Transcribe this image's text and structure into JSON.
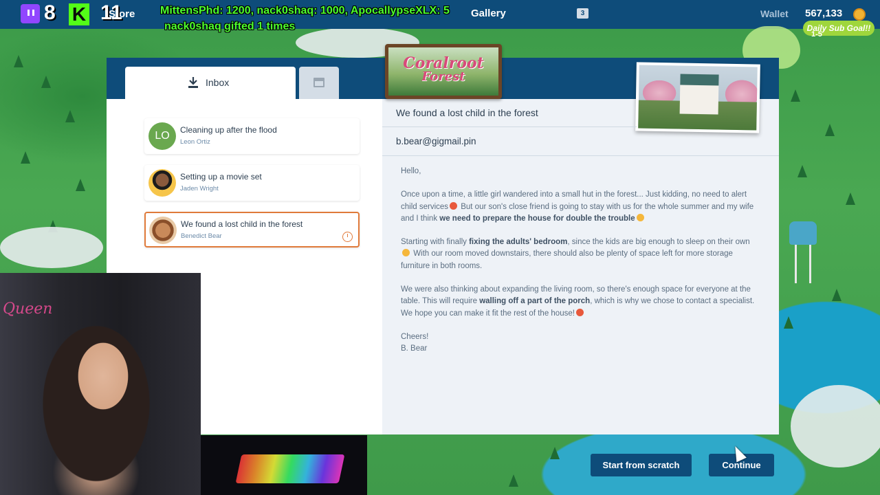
{
  "stream_overlay": {
    "twitch_viewers": "8",
    "kick_viewers": "11",
    "kick_logo": "K",
    "alert_line1": "MittensPhd: 1200, nack0shaq: 1000, ApocallypseXLX: 5",
    "alert_line2": "nack0shaq gifted 1 times",
    "sub_goal_label": "Daily Sub Goal!!",
    "sub_goal_count": "1-5",
    "webcam_sign": "Queen"
  },
  "topbar": {
    "store_label": "Store",
    "gallery_label": "Gallery",
    "badge_count": "3",
    "wallet_label": "Wallet",
    "wallet_value": "567,133"
  },
  "logo": {
    "line1": "Coralroot",
    "line2": "Forest"
  },
  "tabs": {
    "inbox_label": "Inbox"
  },
  "mail_list": [
    {
      "subject": "Cleaning up after the flood",
      "sender": "Leon Ortiz",
      "initials": "LO"
    },
    {
      "subject": "Setting up a movie set",
      "sender": "Jaden Wright"
    },
    {
      "subject": "We found a lost child in the forest",
      "sender": "Benedict Bear"
    }
  ],
  "mail": {
    "subject": "We found a lost child in the forest",
    "from": "b.bear@gigmail.pin",
    "greeting": "Hello,",
    "p1_a": "Once upon a time, a little girl wandered into a small hut in the forest... Just kidding, no need to alert child services",
    "p1_b": " But our son's close friend is going to stay with us for the whole summer and my wife and I think ",
    "p1_bold": "we need to prepare the house for double the trouble",
    "p2_a": "Starting with finally ",
    "p2_bold": "fixing the adults' bedroom",
    "p2_b": ", since the kids are big enough to sleep on their own",
    "p2_c": " With our room moved downstairs, there should also be plenty of space left for more storage furniture in both rooms.",
    "p3_a": "We were also thinking about expanding the living room, so there's enough space for everyone at the table. This will require ",
    "p3_bold": "walling off a part of the porch",
    "p3_b": ", which is why we chose to contact a specialist. We hope you can make it fit the rest of the house!",
    "signoff": "Cheers!",
    "signature": "B. Bear"
  },
  "buttons": {
    "start_from_scratch": "Start from scratch",
    "continue": "Continue"
  },
  "colors": {
    "topbar": "#0e4c7a",
    "accent_selected": "#e07a3a",
    "button": "#0e4c7a",
    "alert_text": "#4dff2e"
  }
}
